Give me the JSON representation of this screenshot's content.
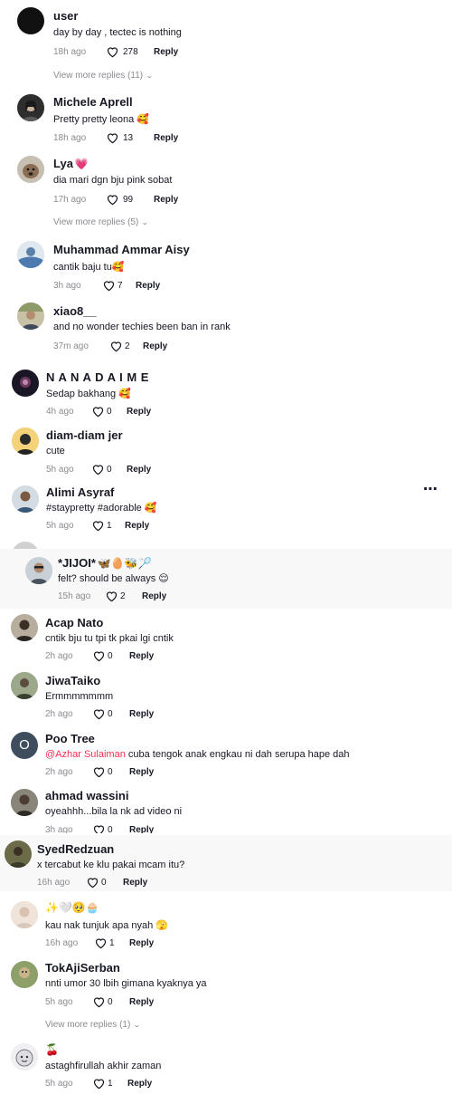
{
  "comments": [
    {
      "name": "user",
      "name_emoji": "",
      "text": "day by day , tectec is nothing",
      "time": "18h ago",
      "likes": "278",
      "reply": "Reply",
      "view_more": "View more replies (11)",
      "avatar": "#161616"
    },
    {
      "name": "Michele Aprell",
      "name_emoji": "",
      "text": "Pretty pretty leona 🥰",
      "time": "18h ago",
      "likes": "13",
      "reply": "Reply",
      "view_more": "",
      "avatar": "#3a3a3a"
    },
    {
      "name": "Lya",
      "name_emoji": "💗",
      "text": "dia mari dgn bju pink sobat",
      "time": "17h ago",
      "likes": "99",
      "reply": "Reply",
      "view_more": "View more replies (5)",
      "avatar": "#8a7a6a"
    },
    {
      "name": "Muhammad Ammar Aisy",
      "name_emoji": "",
      "text": "cantik baju tu🥰",
      "time": "3h ago",
      "likes": "7",
      "reply": "Reply",
      "view_more": "",
      "avatar": "#6c8fb5"
    },
    {
      "name": "xiao8__",
      "name_emoji": "",
      "text": "and no wonder techies been ban in rank",
      "time": "37m ago",
      "likes": "2",
      "reply": "Reply",
      "view_more": "",
      "avatar": "#9a9a80"
    },
    {
      "name": "N A N A D A I M E",
      "name_emoji": "",
      "text": "Sedap bakhang 🥰",
      "time": "4h ago",
      "likes": "0",
      "reply": "Reply",
      "view_more": "",
      "avatar": "#2a1f3a"
    },
    {
      "name": "diam-diam jer",
      "name_emoji": "",
      "text": "cute",
      "time": "5h ago",
      "likes": "0",
      "reply": "Reply",
      "view_more": "",
      "avatar": "#e6c46a"
    },
    {
      "name": "Alimi Asyraf",
      "name_emoji": "",
      "text": "#staypretty #adorable 🥰",
      "time": "5h ago",
      "likes": "1",
      "reply": "Reply",
      "view_more": "",
      "avatar": "#58708a"
    },
    {
      "name": "*JIJOI*",
      "name_emoji": "🦋🥚🐝🏸",
      "text": "felt? should be always 😌",
      "time": "15h ago",
      "likes": "2",
      "reply": "Reply",
      "view_more": "",
      "avatar": "#7d8a95"
    },
    {
      "name": "Acap Nato",
      "name_emoji": "",
      "text": "cntik bju tu tpi tk pkai lgi cntik",
      "time": "2h ago",
      "likes": "0",
      "reply": "Reply",
      "view_more": "",
      "avatar": "#4a4038"
    },
    {
      "name": "JiwaTaiko",
      "name_emoji": "",
      "text": "Ermmmmmmm",
      "time": "2h ago",
      "likes": "0",
      "reply": "Reply",
      "view_more": "",
      "avatar": "#6d7560"
    },
    {
      "name": "Poo Tree",
      "name_emoji": "",
      "mention": "@Azhar Sulaiman",
      "text": " cuba tengok anak engkau ni dah serupa hape dah",
      "time": "2h ago",
      "likes": "0",
      "reply": "Reply",
      "view_more": "",
      "avatar": "#3f4e5e",
      "initial": "O"
    },
    {
      "name": "ahmad wassini",
      "name_emoji": "",
      "text": "oyeahhh...bila la nk ad video ni",
      "time": "3h ago",
      "likes": "0",
      "reply": "Reply",
      "view_more": "",
      "avatar": "#57524a"
    },
    {
      "name": "SyedRedzuan",
      "name_emoji": "",
      "text": "x tercabut ke klu pakai mcam itu?",
      "time": "16h ago",
      "likes": "0",
      "reply": "Reply",
      "view_more": "",
      "avatar": "#5a5a3a"
    },
    {
      "name": "",
      "name_emoji": "✨🤍🥺🧁",
      "text": "kau nak tunjuk apa nyah 🫣",
      "time": "16h ago",
      "likes": "1",
      "reply": "Reply",
      "view_more": "",
      "avatar": "#e8d8cc"
    },
    {
      "name": "TokAjiSerban",
      "name_emoji": "",
      "text": "nnti umor 30 lbih gimana kyaknya ya",
      "time": "5h ago",
      "likes": "0",
      "reply": "Reply",
      "view_more": "View more replies (1)",
      "avatar": "#7a8a5a"
    },
    {
      "name": "",
      "name_emoji": "🍒",
      "text": "astaghfirullah akhir zaman",
      "time": "5h ago",
      "likes": "1",
      "reply": "Reply",
      "view_more": "",
      "avatar": "#d8d8dc"
    }
  ],
  "more_icon": "ellipsis-icon",
  "heart_icon": "heart-outline-icon"
}
